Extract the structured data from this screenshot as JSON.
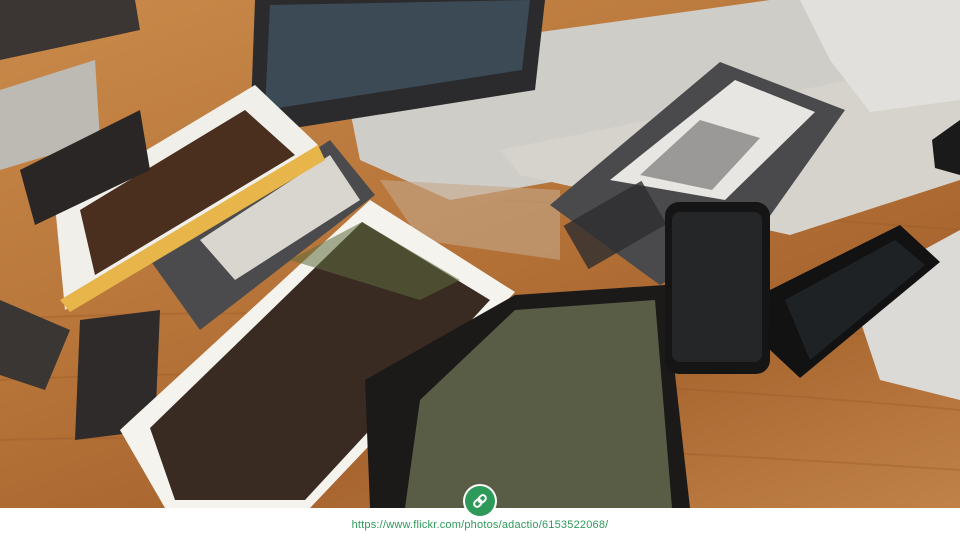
{
  "photo": {
    "subject": "pile-of-devices"
  },
  "source": {
    "url": "https://www.flickr.com/photos/adactio/6153522068/",
    "link_icon": "link-icon"
  },
  "colors": {
    "accent": "#2e9a5a",
    "wood": "#b9773b"
  }
}
